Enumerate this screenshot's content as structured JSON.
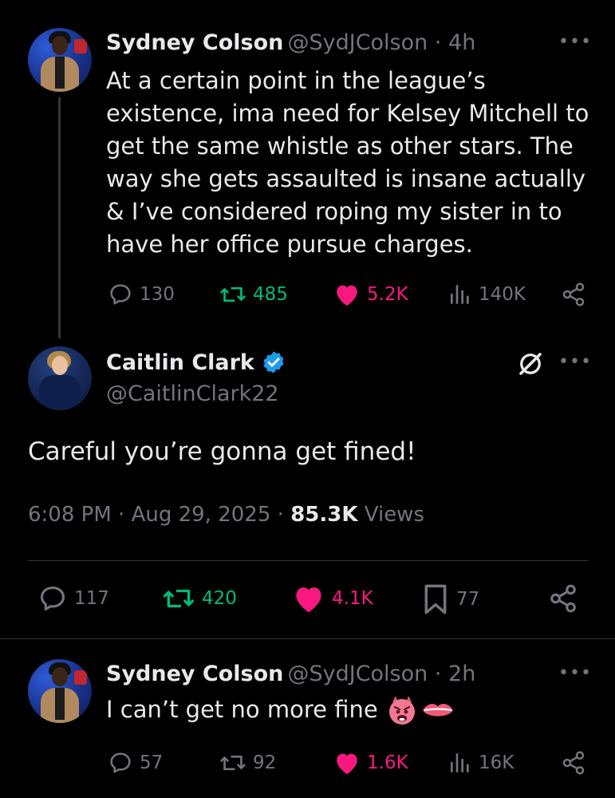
{
  "tweet1": {
    "name": "Sydney Colson",
    "handle": "@SydJColson",
    "sep": " · ",
    "time": "4h",
    "text": "At a certain point in the league’s existence, ima need for Kelsey Mitchell to get the same whistle as other stars. The way she gets assaulted is insane actually & I’ve considered roping my sister in to have her office pursue charges.",
    "replies": "130",
    "reposts": "485",
    "likes": "5.2K",
    "views": "140K"
  },
  "tweet2": {
    "name": "Caitlin Clark",
    "handle": "@CaitlinClark22",
    "text": "Careful you’re gonna get fined!",
    "time": "6:08 PM",
    "sep": " · ",
    "date": "Aug 29, 2025",
    "views_count": "85.3K",
    "views_label": "Views",
    "replies": "117",
    "reposts": "420",
    "likes": "4.1K",
    "bookmarks": "77"
  },
  "tweet3": {
    "name": "Sydney Colson",
    "handle": "@SydJColson",
    "sep": " · ",
    "time": "2h",
    "text": "I can’t get no more fine",
    "replies": "57",
    "reposts": "92",
    "likes": "1.6K",
    "views": "16K"
  },
  "colors": {
    "background": "#000000",
    "text": "#e7e9ea",
    "muted": "#71767b",
    "repost": "#00ba7c",
    "like": "#f91880",
    "verified": "#1d9bf0"
  },
  "icons": {
    "reply": "reply-icon",
    "repost": "repost-icon",
    "like": "heart-icon",
    "views": "views-icon",
    "share": "share-icon",
    "bookmark": "bookmark-icon",
    "more": "more-icon",
    "verified": "verified-badge-icon",
    "grok": "grok-icon"
  }
}
